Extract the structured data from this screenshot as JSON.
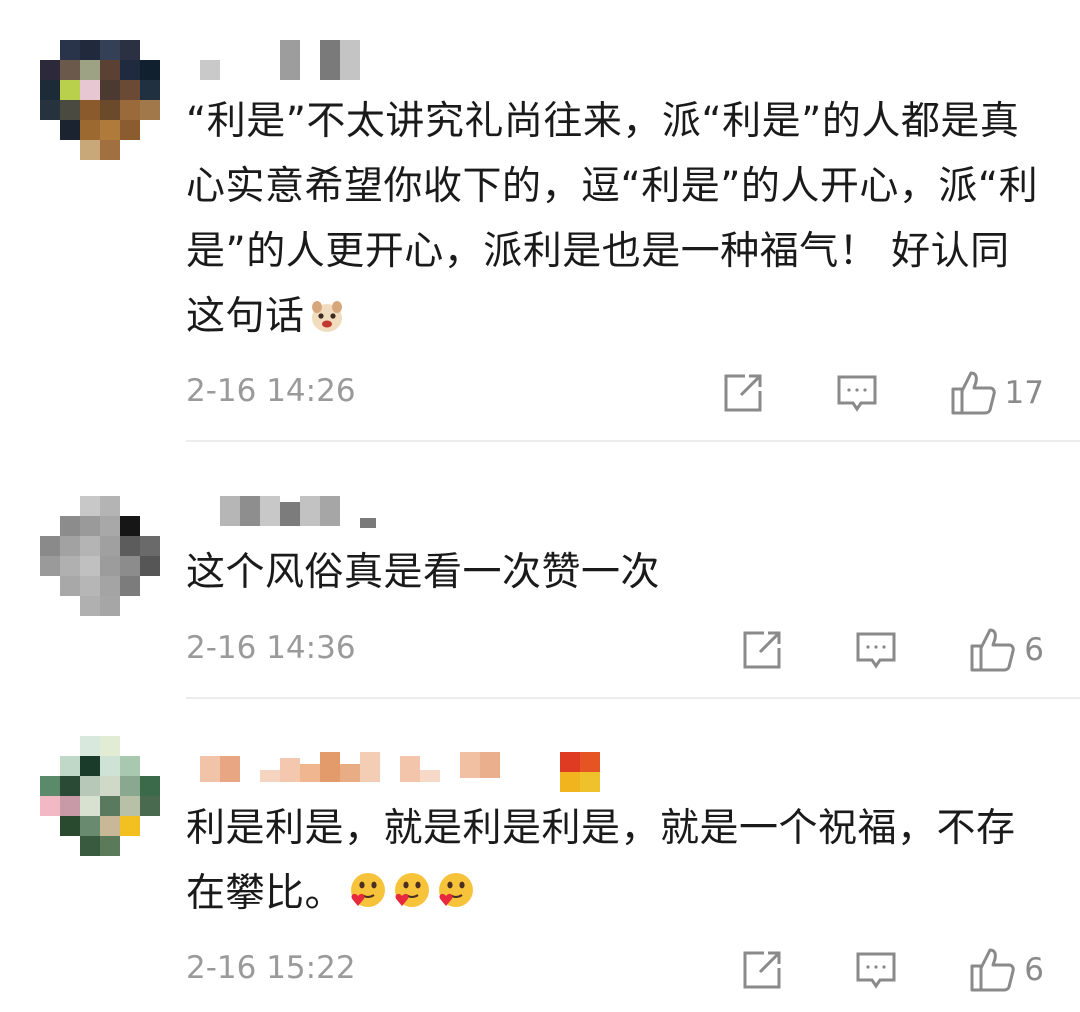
{
  "comments": [
    {
      "text": "“利是”不太讲究礼尚往来，派“利是”的人都是真心实意希望你收下的，逗“利是”的人开心，派“利是”的人更开心，派利是也是一种福气！  好认同这句话",
      "emoji": "doge-face-icon",
      "time": "2-16 14:26",
      "likes": "17"
    },
    {
      "text": "这个风俗真是看一次赞一次",
      "time": "2-16 14:36",
      "likes": "6"
    },
    {
      "text": "利是利是，就是利是利是，就是一个祝福，不存在攀比。",
      "emoji": "heart-hug-face-icon",
      "time": "2-16 15:22",
      "likes": "6"
    }
  ],
  "colors": {
    "text": "#1a1a1a",
    "meta": "#9a9a9a",
    "icon": "#8a8a8a",
    "divider": "#ececec",
    "emoji_face": "#f7c33a",
    "emoji_heart": "#e8283c"
  }
}
